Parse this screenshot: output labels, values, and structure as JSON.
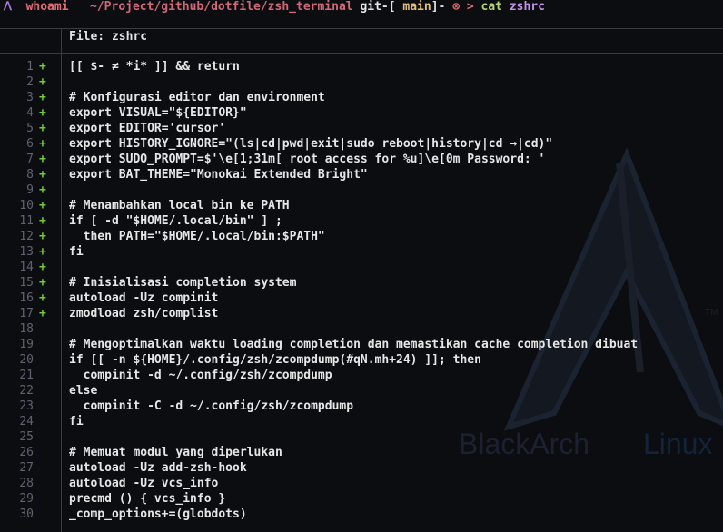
{
  "prompt": {
    "arch_glyph": "ᐱ",
    "user": "whoami",
    "path": "~/Project/github/dotfile/zsh_terminal",
    "git_prefix": "git-[",
    "branch": "main",
    "git_suffix": "]-",
    "error_glyph": "⊗",
    "arrow": ">",
    "command": "cat",
    "argument": "zshrc"
  },
  "file_header": "File: zshrc",
  "lines": [
    {
      "num": "1",
      "mark": "+",
      "text": "[[ $- ≠ *i* ]] && return"
    },
    {
      "num": "2",
      "mark": "+",
      "text": ""
    },
    {
      "num": "3",
      "mark": "+",
      "text": "# Konfigurasi editor dan environment"
    },
    {
      "num": "4",
      "mark": "+",
      "text": "export VISUAL=\"${EDITOR}\""
    },
    {
      "num": "5",
      "mark": "+",
      "text": "export EDITOR='cursor'"
    },
    {
      "num": "6",
      "mark": "+",
      "text": "export HISTORY_IGNORE=\"(ls|cd|pwd|exit|sudo reboot|history|cd →|cd)\""
    },
    {
      "num": "7",
      "mark": "+",
      "text": "export SUDO_PROMPT=$'\\e[1;31m[ root access for %u]\\e[0m Password: '"
    },
    {
      "num": "8",
      "mark": "+",
      "text": "export BAT_THEME=\"Monokai Extended Bright\""
    },
    {
      "num": "9",
      "mark": "+",
      "text": ""
    },
    {
      "num": "10",
      "mark": "+",
      "text": "# Menambahkan local bin ke PATH"
    },
    {
      "num": "11",
      "mark": "+",
      "text": "if [ -d \"$HOME/.local/bin\" ] ;"
    },
    {
      "num": "12",
      "mark": "+",
      "text": "  then PATH=\"$HOME/.local/bin:$PATH\""
    },
    {
      "num": "13",
      "mark": "+",
      "text": "fi"
    },
    {
      "num": "14",
      "mark": "+",
      "text": ""
    },
    {
      "num": "15",
      "mark": "+",
      "text": "# Inisialisasi completion system"
    },
    {
      "num": "16",
      "mark": "+",
      "text": "autoload -Uz compinit"
    },
    {
      "num": "17",
      "mark": "+",
      "text": "zmodload zsh/complist"
    },
    {
      "num": "18",
      "mark": "",
      "text": ""
    },
    {
      "num": "19",
      "mark": "",
      "text": "# Mengoptimalkan waktu loading completion dan memastikan cache completion dibuat"
    },
    {
      "num": "20",
      "mark": "",
      "text": "if [[ -n ${HOME}/.config/zsh/zcompdump(#qN.mh+24) ]]; then"
    },
    {
      "num": "21",
      "mark": "",
      "text": "  compinit -d ~/.config/zsh/zcompdump"
    },
    {
      "num": "22",
      "mark": "",
      "text": "else"
    },
    {
      "num": "23",
      "mark": "",
      "text": "  compinit -C -d ~/.config/zsh/zcompdump"
    },
    {
      "num": "24",
      "mark": "",
      "text": "fi"
    },
    {
      "num": "25",
      "mark": "",
      "text": ""
    },
    {
      "num": "26",
      "mark": "",
      "text": "# Memuat modul yang diperlukan"
    },
    {
      "num": "27",
      "mark": "",
      "text": "autoload -Uz add-zsh-hook"
    },
    {
      "num": "28",
      "mark": "",
      "text": "autoload -Uz vcs_info"
    },
    {
      "num": "29",
      "mark": "",
      "text": "precmd () { vcs_info }"
    },
    {
      "num": "30",
      "mark": "",
      "text": "_comp_options+=(globdots)"
    }
  ],
  "colors": {
    "background": "#0c0d11",
    "diff_added": "#73c936",
    "line_number": "#5f6270",
    "branch": "#e5c07b",
    "path": "#d06878"
  },
  "wallpaper": {
    "logo_icon": "blackarch-logo-icon",
    "brand_left": "BlackArch",
    "brand_right": "Linux",
    "trademark": "TM"
  }
}
